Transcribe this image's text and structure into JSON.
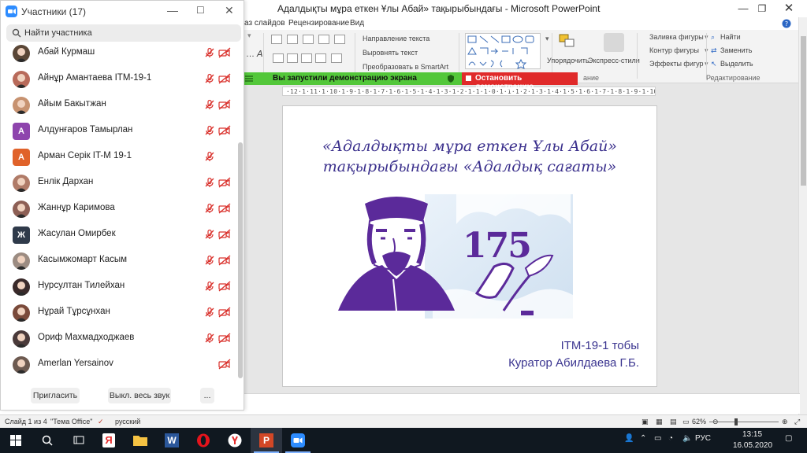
{
  "ppt": {
    "window_title": "Адалдықты мұра еткен Ұлы Абай» тақырыбындағы - Microsoft PowerPoint",
    "tabs": [
      "аз слайдов",
      "Рецензирование",
      "Вид"
    ],
    "ribbon": {
      "text_direction": "Направление текста",
      "align_text": "Выровнять текст",
      "convert_smartart": "Преобразовать в SmartArt",
      "arrange": "Упорядочить",
      "quick_styles": "Экспресс-стили",
      "shape_fill": "Заливка фигуры",
      "shape_outline": "Контур фигуры",
      "shape_effects": "Эффекты фигур",
      "find": "Найти",
      "replace": "Заменить",
      "select": "Выделить",
      "editing_group": "Редактирование",
      "drawing_group": "ание"
    },
    "ruler": "·12·1·11·1·10·1·9·1·8·1·7·1·6·1·5·1·4·1·3·1·2·1·1·1·0·1·1·1·2·1·3·1·4·1·5·1·6·1·7·1·8·1·9·1·10·1·11·1·12·",
    "slide": {
      "title_line1": "«Адалдықты мұра еткен Ұлы Абай»",
      "title_line2": "тақырыбындағы «Адалдық сағаты»",
      "number": "175",
      "group": "ITM-19-1 тобы",
      "curator": "Куратор Абилдаева Г.Б."
    },
    "status": {
      "slide": "Слайд 1 из 4",
      "theme": "\"Тема Office\"",
      "language": "русский",
      "zoom": "62%"
    },
    "colors": {
      "slide_text": "#3b3590",
      "abai_purple": "#5b2a9a",
      "share_green": "#53c73a",
      "share_red": "#e02a2a"
    }
  },
  "sharebar": {
    "message": "Вы запустили демонстрацию экрана",
    "stop": "Остановить демонстрацию"
  },
  "zoom": {
    "title": "Участники (17)",
    "search_placeholder": "Найти участника",
    "participants": [
      {
        "name": "Абай Курмаш",
        "avatar": "photo",
        "color": "#5a4636",
        "cam_off": true,
        "mic_off": true
      },
      {
        "name": "Айнұр Амантаева ITM-19-1",
        "avatar": "photo",
        "color": "#b86a5a",
        "cam_off": true,
        "mic_off": true
      },
      {
        "name": "Айым Бакытжан",
        "avatar": "photo",
        "color": "#c79270",
        "cam_off": true,
        "mic_off": true
      },
      {
        "name": "Алдунғаров Тамырлан",
        "avatar": "letter",
        "letter": "А",
        "color": "#8e44ad",
        "cam_off": true,
        "mic_off": true
      },
      {
        "name": "Арман Серік IT-M 19-1",
        "avatar": "letter",
        "letter": "А",
        "color": "#e0622a",
        "cam_off": false,
        "mic_off": true
      },
      {
        "name": "Енлік Дархан",
        "avatar": "photo",
        "color": "#b07b68",
        "cam_off": true,
        "mic_off": true
      },
      {
        "name": "Жаннұр Каримова",
        "avatar": "photo",
        "color": "#8d5f55",
        "cam_off": true,
        "mic_off": true
      },
      {
        "name": "Жасулан Омирбек",
        "avatar": "letter",
        "letter": "Ж",
        "color": "#2f3a4a",
        "cam_off": true,
        "mic_off": true
      },
      {
        "name": "Касымжомарт Касым",
        "avatar": "photo",
        "color": "#9c8c82",
        "cam_off": true,
        "mic_off": true
      },
      {
        "name": "Нурсултан Тилейхан",
        "avatar": "photo",
        "color": "#3a2a2a",
        "cam_off": true,
        "mic_off": true
      },
      {
        "name": "Нұрай Тұрсұнхан",
        "avatar": "photo",
        "color": "#7a4a3a",
        "cam_off": true,
        "mic_off": true
      },
      {
        "name": "Ориф Махмадходжаев",
        "avatar": "photo",
        "color": "#4a3a3a",
        "cam_off": true,
        "mic_off": true
      },
      {
        "name": "Amerlan Yersainov",
        "avatar": "photo",
        "color": "#6d5a50",
        "cam_off": true,
        "mic_off": false
      }
    ],
    "buttons": {
      "invite": "Пригласить",
      "mute_all": "Выкл. весь звук",
      "more": "..."
    }
  },
  "taskbar": {
    "language": "РУС",
    "time": "13:15",
    "date": "16.05.2020"
  }
}
